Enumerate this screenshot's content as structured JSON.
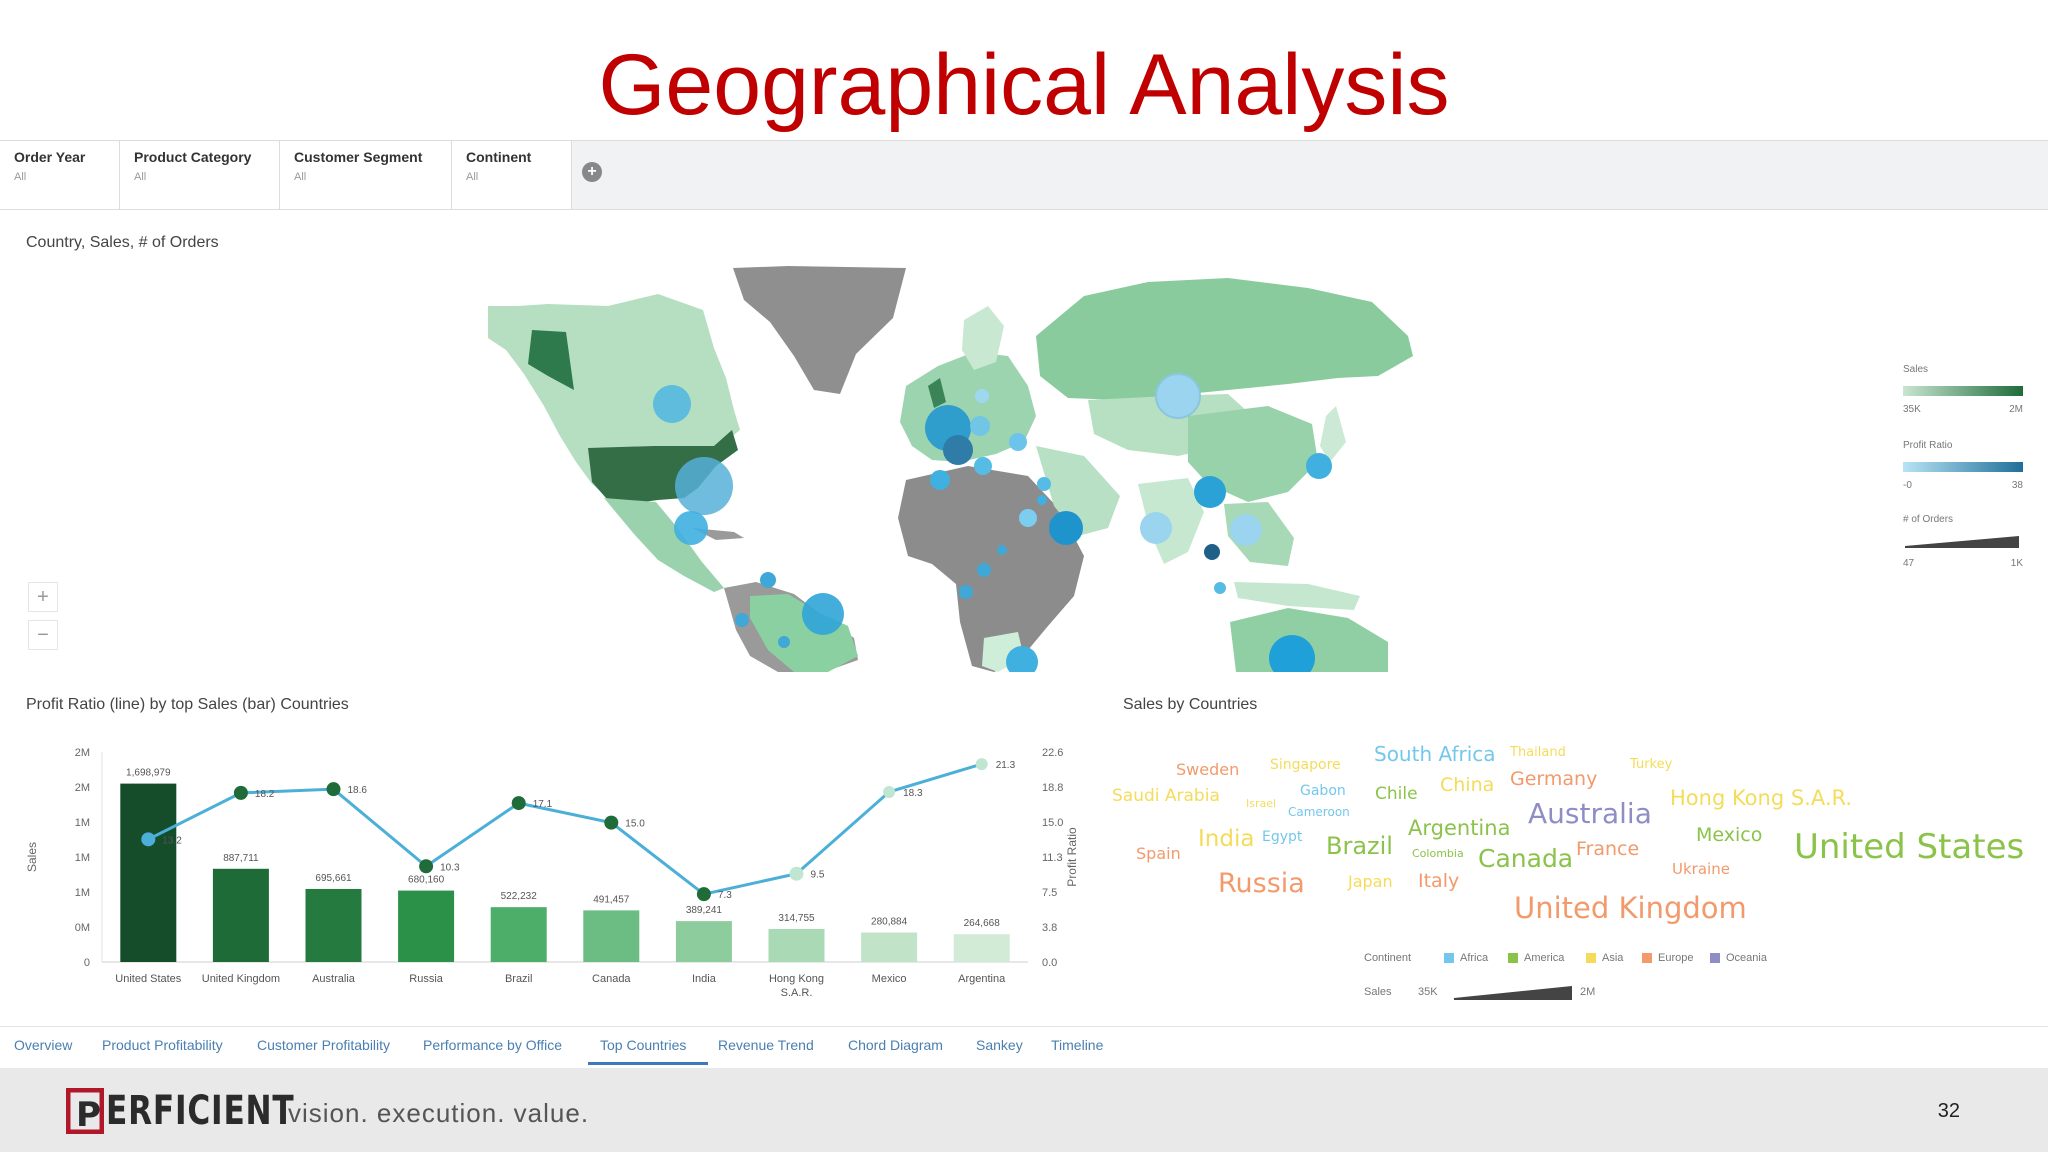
{
  "slide": {
    "title": "Geographical Analysis",
    "page_number": "32",
    "slogan": "vision.  execution.  value.",
    "logo_text": "ERFICIENT",
    "logo_letter": "P"
  },
  "filters": [
    {
      "label": "Order Year",
      "value": "All"
    },
    {
      "label": "Product Category",
      "value": "All"
    },
    {
      "label": "Customer Segment",
      "value": "All"
    },
    {
      "label": "Continent",
      "value": "All"
    }
  ],
  "map_panel": {
    "title": "Country, Sales, # of Orders",
    "zoom_in": "+",
    "zoom_out": "−",
    "legend": {
      "sales_label": "Sales",
      "sales_min": "35K",
      "sales_max": "2M",
      "profit_label": "Profit Ratio",
      "profit_min": "-0",
      "profit_max": "38",
      "orders_label": "# of Orders",
      "orders_min": "47",
      "orders_max": "1K",
      "sales_color_low": "#c8e6d0",
      "sales_color_high": "#1e6b3a",
      "profit_color_low": "#b8e3f5",
      "profit_color_high": "#1f6f99"
    }
  },
  "bar_panel": {
    "title": "Profit Ratio (line) by top Sales (bar) Countries",
    "chart_data": {
      "type": "bar",
      "categories": [
        "United States",
        "United Kingdom",
        "Australia",
        "Russia",
        "Brazil",
        "Canada",
        "India",
        "Hong Kong S.A.R.",
        "Mexico",
        "Argentina"
      ],
      "series": [
        {
          "name": "Sales",
          "values": [
            1698979,
            887711,
            695661,
            680160,
            522232,
            491457,
            389241,
            314755,
            280884,
            264668
          ]
        },
        {
          "name": "Profit Ratio",
          "values": [
            13.2,
            18.2,
            18.6,
            10.3,
            17.1,
            15.0,
            7.3,
            9.5,
            18.3,
            21.3
          ]
        }
      ],
      "bar_labels": [
        "1,698,979",
        "887,711",
        "695,661",
        "680,160",
        "522,232",
        "491,457",
        "389,241",
        "314,755",
        "280,884",
        "264,668"
      ],
      "line_labels": [
        "13.2",
        "18.2",
        "18.6",
        "10.3",
        "17.1",
        "15.0",
        "7.3",
        "9.5",
        "18.3",
        "21.3"
      ],
      "ylabel": "Sales",
      "y2label": "Profit Ratio",
      "y_ticks": [
        "2M",
        "2M",
        "1M",
        "1M",
        "1M",
        "0M",
        "0"
      ],
      "y2_ticks": [
        "22.6",
        "18.8",
        "15.0",
        "11.3",
        "7.5",
        "3.8",
        "0.0"
      ],
      "ylim": [
        0,
        2000000
      ],
      "y2lim": [
        0,
        22.6
      ],
      "bar_colors": [
        "#154d2a",
        "#1e6b38",
        "#257a40",
        "#2b9148",
        "#4dae6a",
        "#6cbd83",
        "#8ccc9d",
        "#a9d9b5",
        "#c1e4c9",
        "#d2ebd6"
      ],
      "line_color": "#4bafd8"
    }
  },
  "cloud_panel": {
    "title": "Sales by Countries",
    "legend_label": "Continent",
    "continents": [
      {
        "name": "Africa",
        "color": "#74c7ec"
      },
      {
        "name": "America",
        "color": "#8bc34a"
      },
      {
        "name": "Asia",
        "color": "#f4dc5a"
      },
      {
        "name": "Europe",
        "color": "#f29a6b"
      },
      {
        "name": "Oceania",
        "color": "#8e8ec4"
      }
    ],
    "sales_label": "Sales",
    "sales_min": "35K",
    "sales_max": "2M",
    "words": [
      {
        "text": "South Africa",
        "cont": "Africa"
      },
      {
        "text": "Thailand",
        "cont": "Asia"
      },
      {
        "text": "Sweden",
        "cont": "Europe"
      },
      {
        "text": "Singapore",
        "cont": "Asia"
      },
      {
        "text": "Turkey",
        "cont": "Asia"
      },
      {
        "text": "Germany",
        "cont": "Europe"
      },
      {
        "text": "Saudi Arabia",
        "cont": "Asia"
      },
      {
        "text": "Israel",
        "cont": "Asia"
      },
      {
        "text": "Gabon",
        "cont": "Africa"
      },
      {
        "text": "Chile",
        "cont": "America"
      },
      {
        "text": "China",
        "cont": "Asia"
      },
      {
        "text": "Hong Kong S.A.R.",
        "cont": "Asia"
      },
      {
        "text": "Cameroon",
        "cont": "Africa"
      },
      {
        "text": "Australia",
        "cont": "Oceania"
      },
      {
        "text": "Argentina",
        "cont": "America"
      },
      {
        "text": "Mexico",
        "cont": "America"
      },
      {
        "text": "India",
        "cont": "Asia"
      },
      {
        "text": "Egypt",
        "cont": "Africa"
      },
      {
        "text": "Brazil",
        "cont": "America"
      },
      {
        "text": "Spain",
        "cont": "Europe"
      },
      {
        "text": "Colombia",
        "cont": "America"
      },
      {
        "text": "Canada",
        "cont": "America"
      },
      {
        "text": "France",
        "cont": "Europe"
      },
      {
        "text": "United States",
        "cont": "America"
      },
      {
        "text": "Ukraine",
        "cont": "Europe"
      },
      {
        "text": "Russia",
        "cont": "Europe"
      },
      {
        "text": "Japan",
        "cont": "Asia"
      },
      {
        "text": "Italy",
        "cont": "Europe"
      },
      {
        "text": "United Kingdom",
        "cont": "Europe"
      }
    ]
  },
  "tabs": [
    {
      "label": "Overview"
    },
    {
      "label": "Product Profitability"
    },
    {
      "label": "Customer Profitability"
    },
    {
      "label": "Performance by Office"
    },
    {
      "label": "Top Countries",
      "active": true
    },
    {
      "label": "Revenue Trend"
    },
    {
      "label": "Chord Diagram"
    },
    {
      "label": "Sankey"
    },
    {
      "label": "Timeline"
    }
  ],
  "colors": {
    "title_red": "#c00000",
    "tab_active": "#3d7ab8"
  }
}
